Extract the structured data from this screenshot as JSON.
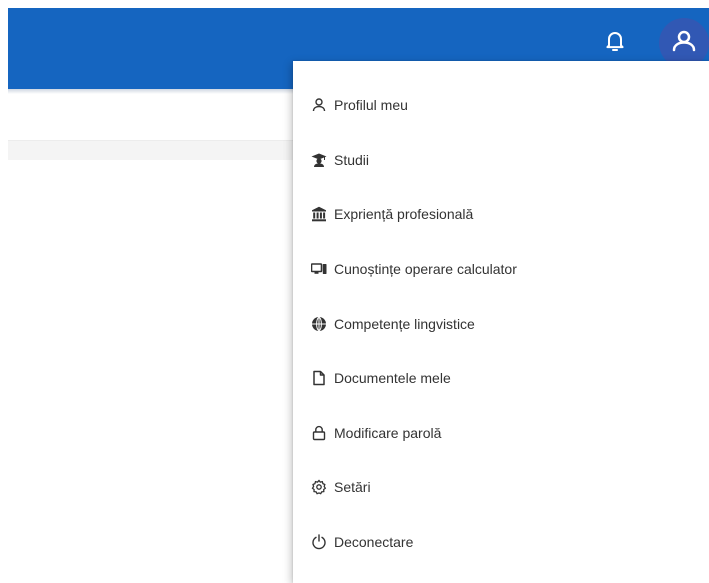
{
  "header": {
    "accent_color": "#1565c0",
    "avatar_color": "#3158b4",
    "notification_icon": "bell-icon",
    "user_icon": "user-icon"
  },
  "user_menu": {
    "items": [
      {
        "label": "Profilul meu",
        "icon": "user-icon"
      },
      {
        "label": "Studii",
        "icon": "graduate-icon"
      },
      {
        "label": "Expriență profesională",
        "icon": "bank-icon"
      },
      {
        "label": "Cunoștințe operare calculator",
        "icon": "computer-icon"
      },
      {
        "label": "Competențe lingvistice",
        "icon": "globe-icon"
      },
      {
        "label": "Documentele mele",
        "icon": "file-icon"
      },
      {
        "label": "Modificare parolă",
        "icon": "lock-icon"
      },
      {
        "label": "Setări",
        "icon": "gear-icon"
      },
      {
        "label": "Deconectare",
        "icon": "power-icon"
      }
    ]
  }
}
